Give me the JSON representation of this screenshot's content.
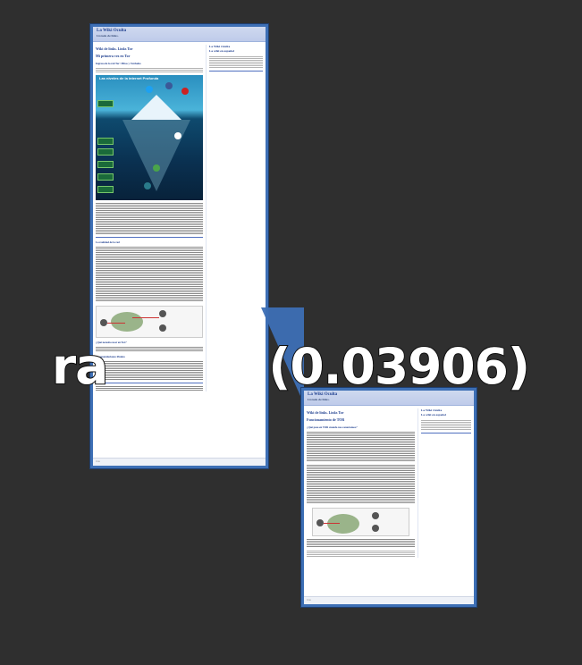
{
  "overlay": {
    "prefix": "ra",
    "suffix": "(0.03906)"
  },
  "page_a": {
    "header_title": "La Wiki Oculta",
    "header_subtitle": "Listado de links. ",
    "main_heading": "Wiki de links. Links Tor",
    "sub_heading": "Mi primera vez en Tor",
    "section_heading": "Ingresa de la red Tor: Mitos y Verdades",
    "image_title": "Las niveles de la internet Profunda",
    "section_heading_2": "La realidad de la red",
    "section_heading_3": "¿Qué necesito usar en Tor?",
    "section_heading_4": "Recomendaciones Finales",
    "side_title": "La Wiki Oculta",
    "side_subtitle": "La wiki en español",
    "footer": "TOR"
  },
  "page_b": {
    "header_title": "La Wiki Oculta",
    "header_subtitle": "Listado de links. ",
    "main_heading": "Wiki de links. Links Tor",
    "sub_heading": "Funcionamiento de TOR",
    "section_heading": "¿Qué pasa en TOR cuando nos conectamos?",
    "side_title": "La Wiki Oculta",
    "side_subtitle": "La wiki en español",
    "footer": "TOR"
  },
  "colors": {
    "background": "#2f2f2f",
    "page_border": "#3d6fb5",
    "header_bg": "#cfd9ef",
    "heading_text": "#1f3f8f"
  }
}
